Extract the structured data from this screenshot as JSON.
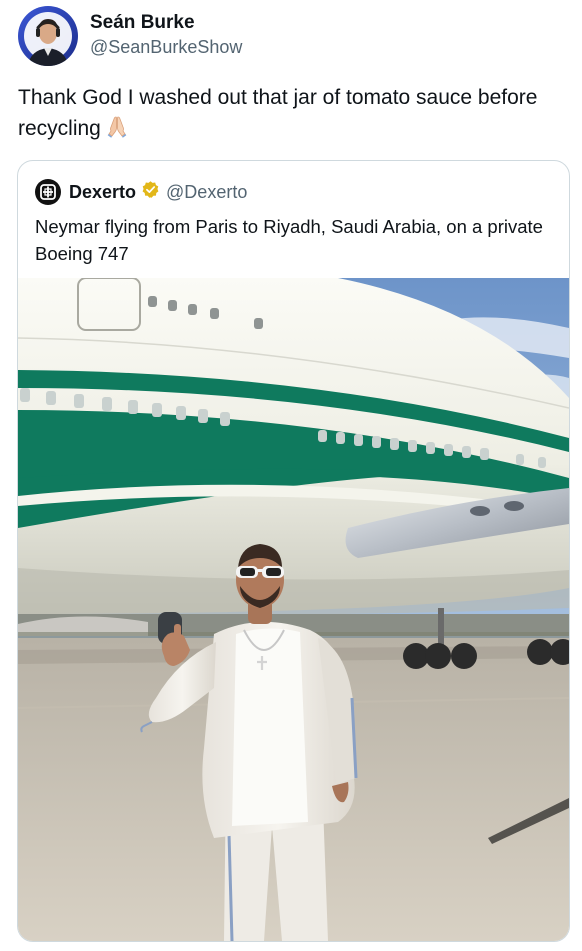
{
  "author": {
    "display_name": "Seán Burke",
    "handle": "@SeanBurkeShow"
  },
  "tweet": {
    "text": "Thank God I washed out that jar of tomato sauce before recycling",
    "emoji": "folded-hands"
  },
  "quoted": {
    "display_name": "Dexerto",
    "handle": "@Dexerto",
    "verified": "gold",
    "text": "Neymar flying from Paris to Riyadh, Saudi Arabia, on a private Boeing 747"
  },
  "colors": {
    "text_primary": "#0f1419",
    "text_secondary": "#536471",
    "border": "#cfd9de",
    "verified_gold": "#e2b719",
    "aircraft_stripe": "#0f7a5e"
  }
}
